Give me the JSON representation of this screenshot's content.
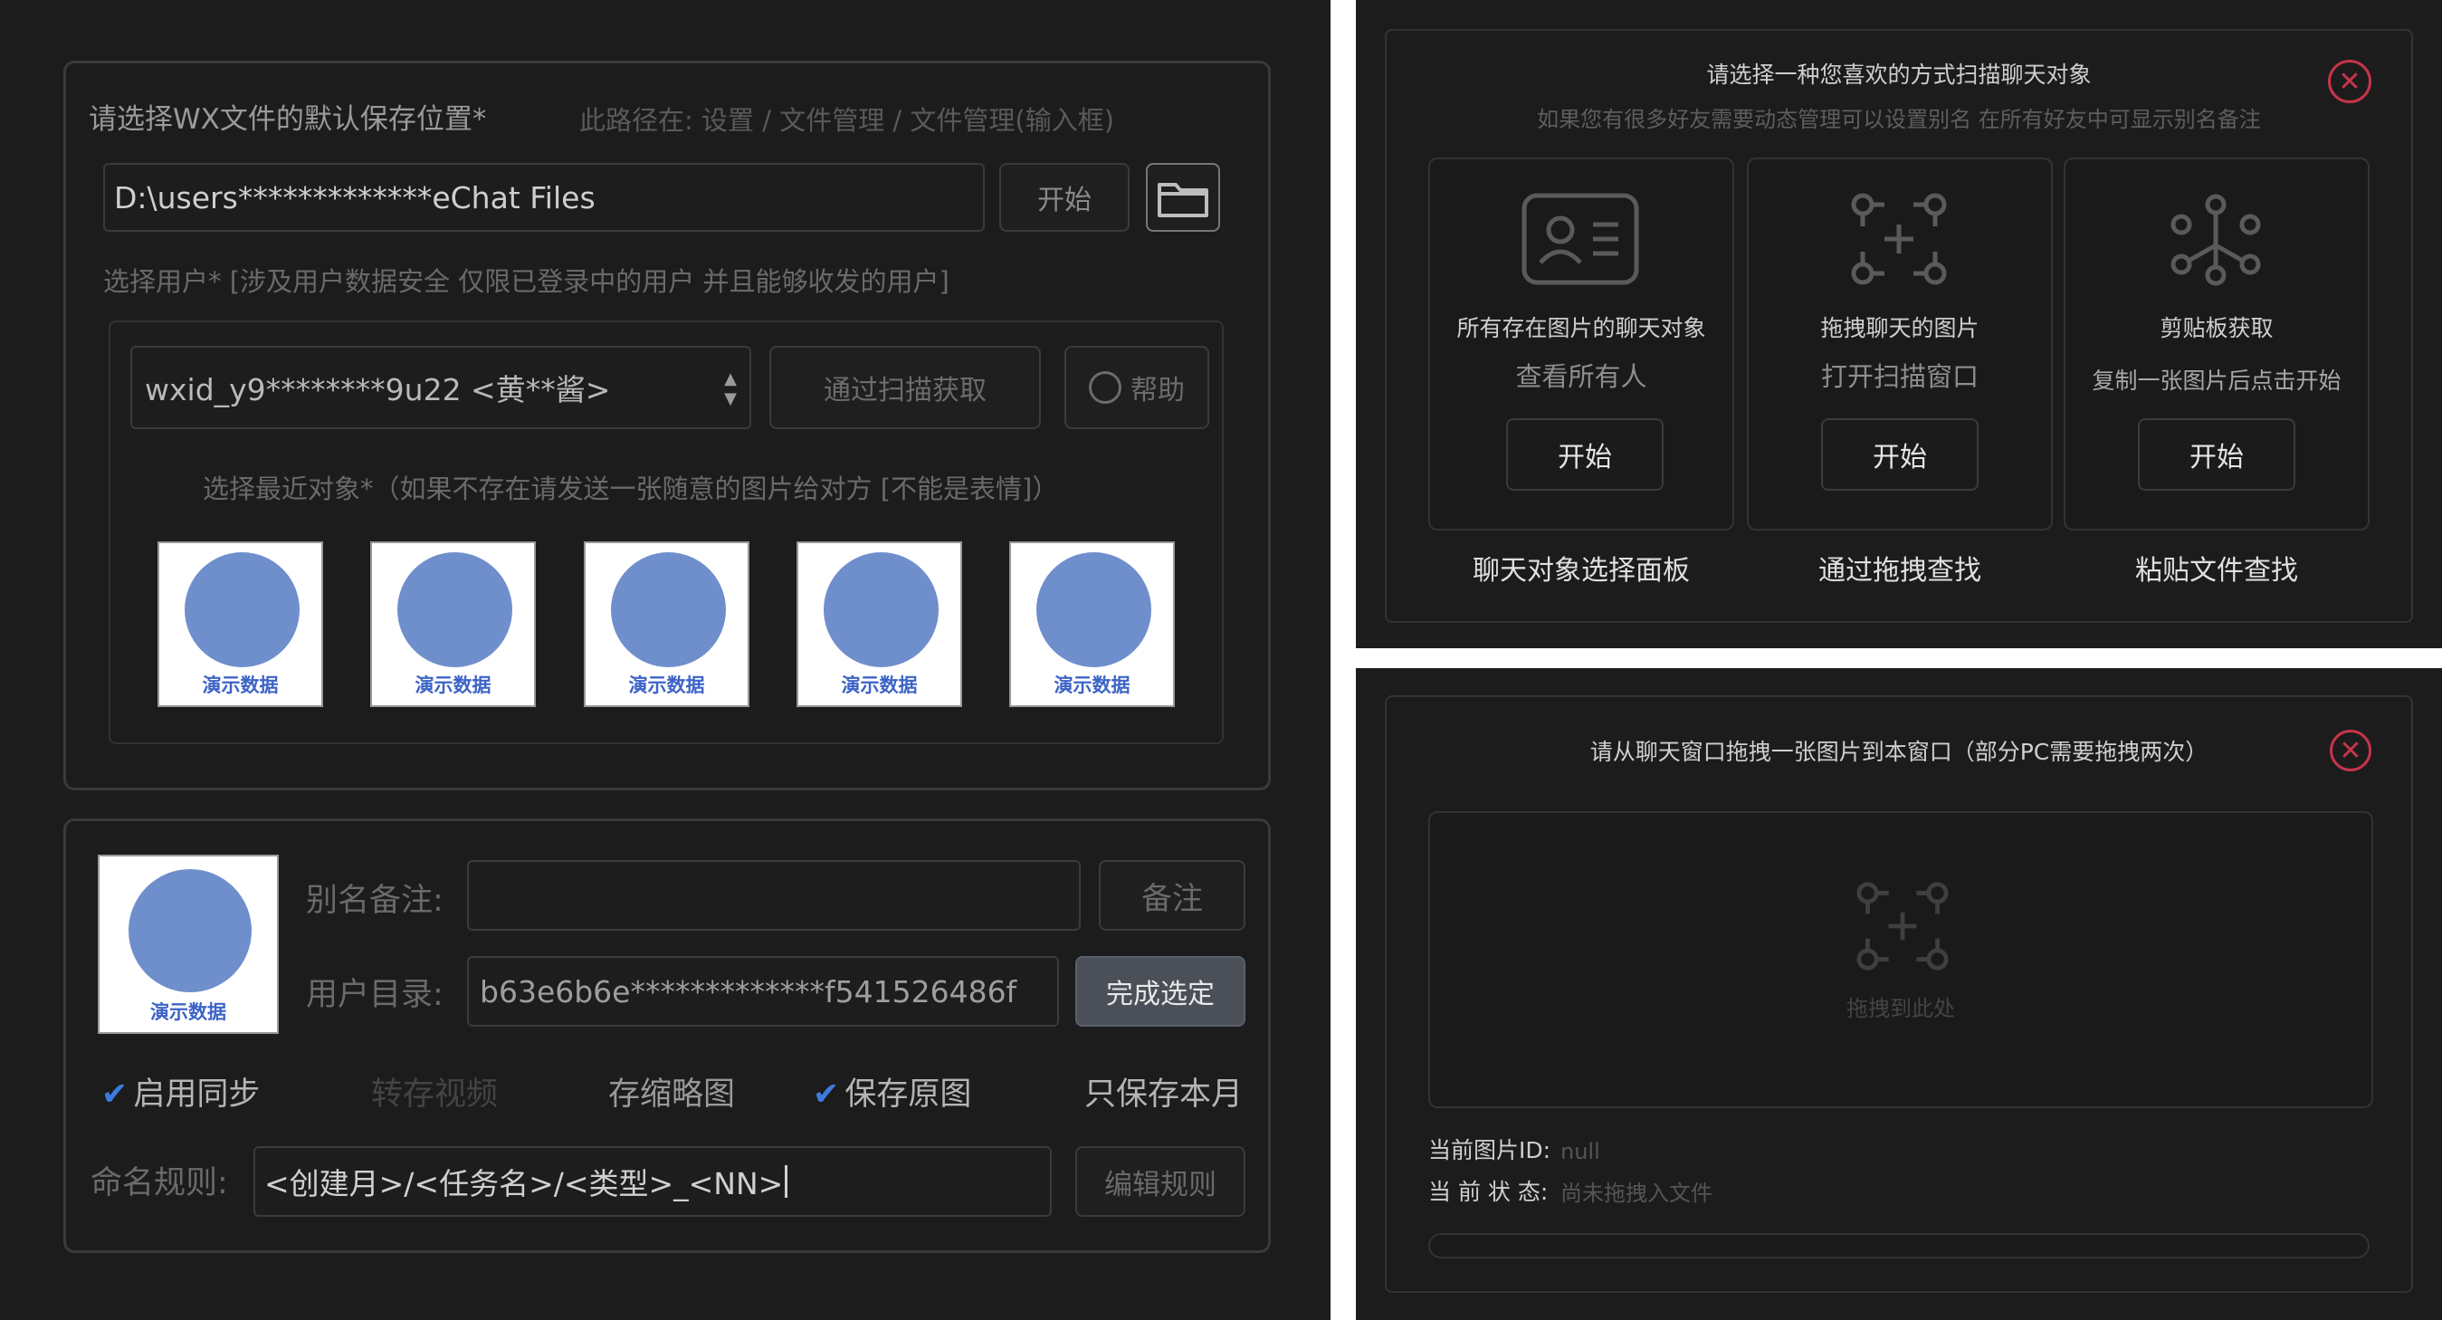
{
  "left": {
    "save_label": "请选择WX文件的默认保存位置*",
    "path_hint": "此路径在:  设置  /  文件管理  /  文件管理(输入框)",
    "path_value": "D:\\users*************eChat Files",
    "start_btn": "开始",
    "user_label": "选择用户*  [涉及用户数据安全  仅限已登录中的用户 并且能够收发的用户]",
    "user_select": "wxid_y9********9u22 <黄**酱>",
    "scan_btn": "通过扫描获取",
    "help_btn": "帮助",
    "recent_label": "选择最近对象*（如果不存在请发送一张随意的图片给对方 [不能是表情]）",
    "thumb_caption": "演示数据",
    "alias_label": "别名备注:",
    "alias_value": "",
    "note_btn": "备注",
    "dir_label": "用户目录:",
    "dir_value": "b63e6b6e*************f541526486f",
    "done_btn": "完成选定",
    "options": [
      {
        "label": "启用同步",
        "checked": true
      },
      {
        "label": "转存视频",
        "checked": false
      },
      {
        "label": "存缩略图",
        "checked": false
      },
      {
        "label": "保存原图",
        "checked": true
      },
      {
        "label": "只保存本月",
        "checked": false
      }
    ],
    "naming_label": "命名规则:",
    "naming_value": "<创建月>/<任务名>/<类型>_<NN>",
    "edit_btn": "编辑规则"
  },
  "top_right": {
    "title": "请选择一种您喜欢的方式扫描聊天对象",
    "subtitle": "如果您有很多好友需要动态管理可以设置别名 在所有好友中可显示别名备注",
    "cards": [
      {
        "line1": "所有存在图片的聊天对象",
        "line2": "查看所有人",
        "btn": "开始",
        "footer": "聊天对象选择面板",
        "icon": "contact-card-icon"
      },
      {
        "line1": "拖拽聊天的图片",
        "line2": "打开扫描窗口",
        "btn": "开始",
        "footer": "通过拖拽查找",
        "icon": "drag-scan-icon"
      },
      {
        "line1": "剪贴板获取",
        "line2": "复制一张图片后点击开始",
        "btn": "开始",
        "footer": "粘贴文件查找",
        "icon": "network-nodes-icon"
      }
    ]
  },
  "bottom_right": {
    "title": "请从聊天窗口拖拽一张图片到本窗口（部分PC需要拖拽两次）",
    "drop_text": "拖拽到此处",
    "id_label": "当前图片ID:",
    "id_value": "null",
    "status_label": "当 前 状 态:",
    "status_value": "尚未拖拽入文件"
  }
}
